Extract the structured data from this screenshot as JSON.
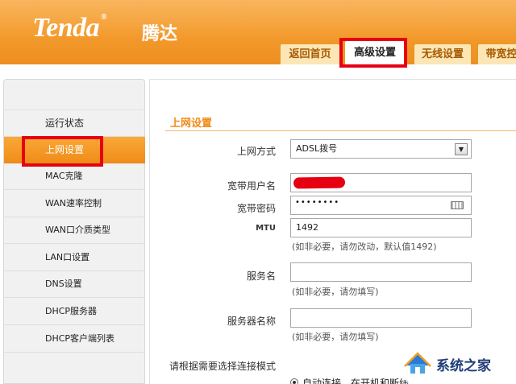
{
  "brand": {
    "logo": "Tenda",
    "logo_mark": "®",
    "logo_cn": "腾达"
  },
  "tabs": [
    {
      "label": "返回首页"
    },
    {
      "label": "高级设置",
      "active": true
    },
    {
      "label": "无线设置"
    },
    {
      "label": "带宽控"
    }
  ],
  "sidebar": {
    "items": [
      {
        "label": "运行状态"
      },
      {
        "label": "上网设置",
        "active": true
      },
      {
        "label": "MAC克隆"
      },
      {
        "label": "WAN速率控制"
      },
      {
        "label": "WAN口介质类型"
      },
      {
        "label": "LAN口设置"
      },
      {
        "label": "DNS设置"
      },
      {
        "label": "DHCP服务器"
      },
      {
        "label": "DHCP客户端列表"
      }
    ]
  },
  "main": {
    "title": "上网设置",
    "connection_type": {
      "label": "上网方式",
      "value": "ADSL拨号"
    },
    "username": {
      "label": "宽带用户名",
      "value": ""
    },
    "password": {
      "label": "宽带密码",
      "value": "••••••••"
    },
    "mtu": {
      "label": "MTU",
      "value": "1492",
      "hint": "(如非必要，请勿改动，默认值1492)"
    },
    "service_name": {
      "label": "服务名",
      "value": "",
      "hint": "(如非必要，请勿填写)"
    },
    "server_name": {
      "label": "服务器名称",
      "value": "",
      "hint": "(如非必要，请勿填写)"
    },
    "connect_mode": {
      "label": "请根据需要选择连接模式",
      "option": "自动连接，在开机和断线"
    }
  },
  "watermark": {
    "text": "系统之家"
  },
  "colors": {
    "brand_orange": "#f39a2c",
    "highlight_red": "#e60012",
    "title_orange": "#f08b16"
  }
}
